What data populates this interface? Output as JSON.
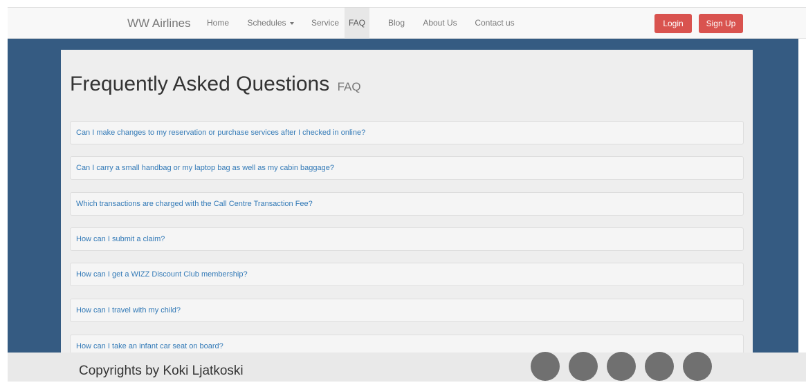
{
  "navbar": {
    "brand": "WW Airlines",
    "links": [
      {
        "label": "Home"
      },
      {
        "label": "Schedules"
      },
      {
        "label": "Service"
      },
      {
        "label": "FAQ",
        "active": true
      },
      {
        "label": "Blog"
      },
      {
        "label": "About Us"
      },
      {
        "label": "Contact us"
      }
    ],
    "login_label": "Login",
    "signup_label": "Sign Up"
  },
  "page": {
    "title": "Frequently Asked Questions",
    "title_small": "FAQ"
  },
  "faq": [
    {
      "question": "Can I make changes to my reservation or purchase services after I checked in online?"
    },
    {
      "question": "Can I carry a small handbag or my laptop bag as well as my cabin baggage?"
    },
    {
      "question": "Which transactions are charged with the Call Centre Transaction Fee?"
    },
    {
      "question": "How can I submit a claim?"
    },
    {
      "question": "How can I get a WIZZ Discount Club membership?"
    },
    {
      "question": "How can I travel with my child?"
    },
    {
      "question": "How can I take an infant car seat on board?"
    }
  ],
  "footer": {
    "copyright": "Copyrights by Koki Ljatkoski",
    "social_count": 5
  },
  "colors": {
    "background_blue": "#355b82",
    "button_red": "#d9534f",
    "link_blue": "#337ab7",
    "social_gray": "#707070"
  }
}
